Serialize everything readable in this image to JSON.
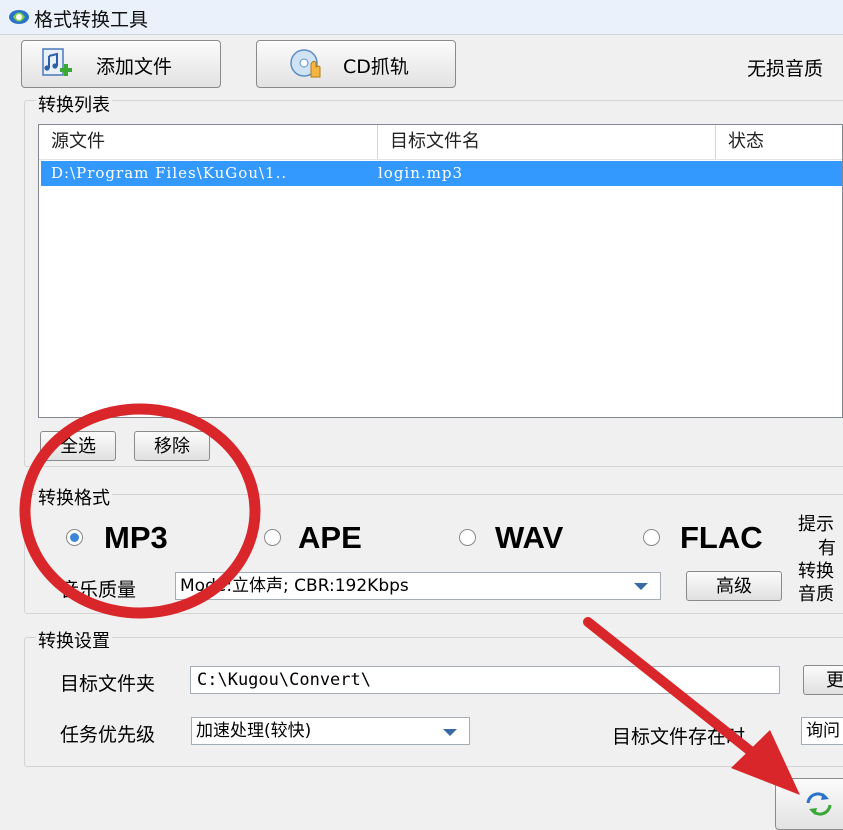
{
  "window": {
    "title": "格式转换工具"
  },
  "toolbar": {
    "add_files_label": "添加文件",
    "cd_rip_label": "CD抓轨",
    "lossless_label": "无损音质"
  },
  "list_group": {
    "title": "转换列表",
    "columns": [
      "源文件",
      "目标文件名",
      "状态"
    ],
    "rows": [
      {
        "source": "D:\\Program Files\\KuGou\\1..",
        "target": "login.mp3",
        "status": ""
      }
    ],
    "select_all_label": "全选",
    "remove_label": "移除"
  },
  "format_group": {
    "title": "转换格式",
    "formats": [
      {
        "label": "MP3",
        "selected": true
      },
      {
        "label": "APE",
        "selected": false
      },
      {
        "label": "WAV",
        "selected": false
      },
      {
        "label": "FLAC",
        "selected": false
      }
    ],
    "quality_label": "音乐质量",
    "quality_value": "Mode:立体声; CBR:192Kbps",
    "advanced_label": "高级",
    "hint_lines": [
      "提示",
      "有",
      "转换",
      "音质"
    ]
  },
  "settings_group": {
    "title": "转换设置",
    "target_folder_label": "目标文件夹",
    "target_folder_value": "C:\\Kugou\\Convert\\",
    "change_label": "更",
    "priority_label": "任务优先级",
    "priority_value": "加速处理(较快)",
    "exists_label": "目标文件存在时",
    "exists_value": "询问"
  },
  "colors": {
    "selection": "#3399ff",
    "annotation_red": "#d9262a",
    "radio_dot": "#3d86d8"
  },
  "icons": [
    "app-logo-icon",
    "add-file-icon",
    "cd-disc-icon",
    "convert-icon"
  ]
}
